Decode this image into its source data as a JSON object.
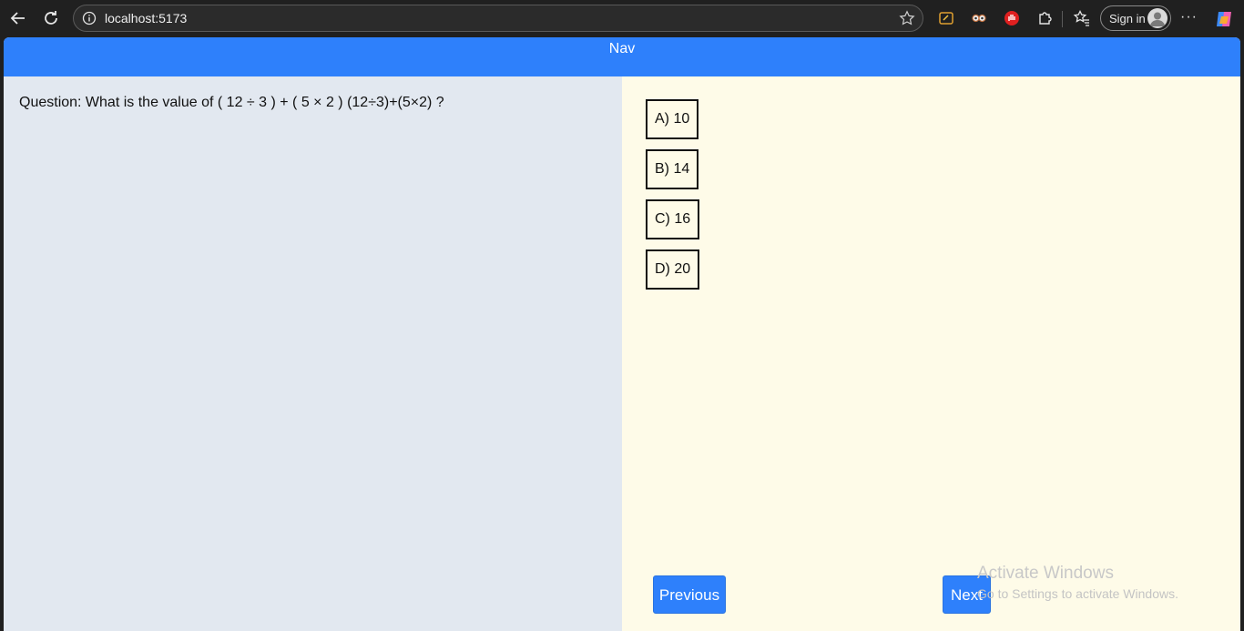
{
  "browser": {
    "url": "localhost:5173",
    "sign_in_label": "Sign in",
    "more_label": "···"
  },
  "navbar": {
    "title": "Nav"
  },
  "question": {
    "text": "Question: What is the value of ( 12 ÷ 3 ) + ( 5 × 2 ) (12÷3)+(5×2) ?"
  },
  "options": [
    {
      "label": "A) 10"
    },
    {
      "label": "B) 14"
    },
    {
      "label": "C) 16"
    },
    {
      "label": "D) 20"
    }
  ],
  "buttons": {
    "previous": "Previous",
    "next": "Next"
  },
  "watermark": {
    "title": "Activate Windows",
    "subtitle": "Go to Settings to activate Windows."
  },
  "colors": {
    "nav_blue": "#2e80fb",
    "left_bg": "#e2e8f0",
    "right_bg": "#fefbe8"
  }
}
